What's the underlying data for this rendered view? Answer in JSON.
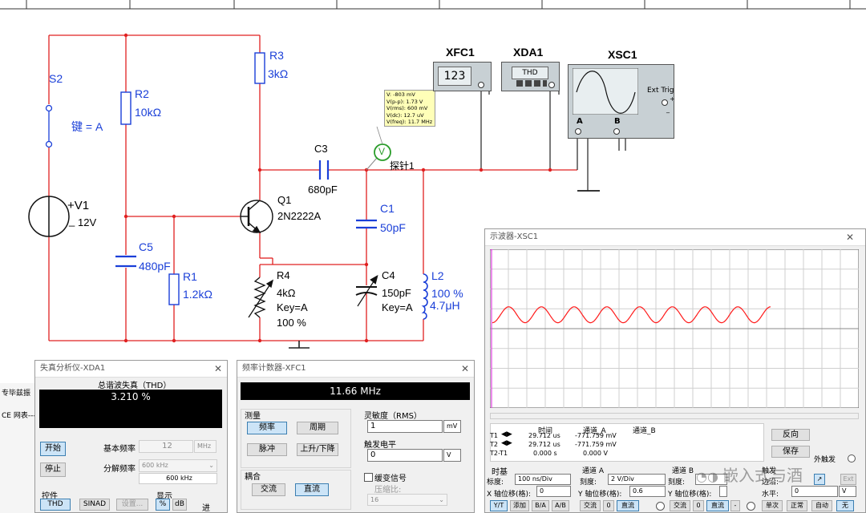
{
  "schematic": {
    "s2": {
      "name": "S2",
      "key": "键 = A"
    },
    "v1": {
      "name": "+V1",
      "value": "12V",
      "minus": "_"
    },
    "r2": {
      "name": "R2",
      "value": "10kΩ"
    },
    "r3": {
      "name": "R3",
      "value": "3kΩ"
    },
    "q1": {
      "name": "Q1",
      "model": "2N2222A"
    },
    "c5": {
      "name": "C5",
      "value": "480pF"
    },
    "r1": {
      "name": "R1",
      "value": "1.2kΩ"
    },
    "r4": {
      "name": "R4",
      "value": "4kΩ",
      "key": "Key=A",
      "percent": "100 %"
    },
    "c3": {
      "name": "C3",
      "value": "680pF"
    },
    "c1": {
      "name": "C1",
      "value": "50pF"
    },
    "c4": {
      "name": "C4",
      "value": "150pF",
      "key": "Key=A"
    },
    "l2": {
      "name": "L2",
      "percent": "100 %",
      "value": "4.7μH"
    },
    "probe": {
      "name": "探针1",
      "symbol": "V",
      "lines": [
        "V: -803 mV",
        "V(p-p): 1.73 V",
        "V(rms): 600 mV",
        "V(dc): 12.7 uV",
        "V(freq): 11.7 MHz"
      ]
    },
    "xfc1": {
      "name": "XFC1",
      "display": "123"
    },
    "xda1": {
      "name": "XDA1",
      "display": "THD"
    },
    "xsc1": {
      "name": "XSC1",
      "ext_trig": "Ext Trig",
      "ch_a": "A",
      "ch_b": "B",
      "plus": "+",
      "minus": "_"
    }
  },
  "thd_window": {
    "title": "失真分析仪-XDA1",
    "section": "总谐波失真（THD）",
    "value": "3.210 %",
    "start": "开始",
    "stop": "停止",
    "fundamental_label": "基本频率",
    "fundamental_value": "12",
    "fundamental_unit": "MHz",
    "resolution_label": "分解频率",
    "resolution_value": "600 kHz",
    "resolution_display": "600 kHz",
    "control_label": "控件",
    "controls": [
      "THD",
      "SINAD",
      "设置..."
    ],
    "display_label": "显示",
    "display_opts": [
      "%",
      "dB"
    ],
    "extra": "进"
  },
  "left_strip": {
    "items": [
      "专毕兹振",
      "CE 网表---"
    ]
  },
  "freq_window": {
    "title": "频率计数器-XFC1",
    "value": "11.66 MHz",
    "measure_label": "测量",
    "measure_buttons": [
      "频率",
      "周期",
      "脉冲",
      "上升/下降"
    ],
    "coupling_label": "耦合",
    "coupling_buttons": [
      "交流",
      "直流"
    ],
    "sensitivity_label": "灵敏度（RMS）",
    "sensitivity_value": "1",
    "sensitivity_unit": "mV",
    "trigger_label": "触发电平",
    "trigger_value": "0",
    "trigger_unit": "V",
    "slow_label": "缓变信号",
    "compress_label": "压缩比:",
    "compress_value": "16"
  },
  "scope_window": {
    "title": "示波器-XSC1",
    "waveform": {
      "cycles": 8.5,
      "amplitude_div": 0.4,
      "offset_div": 0.7
    },
    "cursor_header": [
      "时间",
      "通道_A",
      "通道_B"
    ],
    "cursor_rows": [
      {
        "label": "T1",
        "time": "29.712 us",
        "a": "-771.759 mV",
        "b": ""
      },
      {
        "label": "T2",
        "time": "29.712 us",
        "a": "-771.759 mV",
        "b": ""
      },
      {
        "label": "T2-T1",
        "time": "0.000 s",
        "a": "0.000 V",
        "b": ""
      }
    ],
    "reverse": "反向",
    "save": "保存",
    "ext_trigger": "外触发",
    "timebase_label": "时基",
    "timebase_scale_label": "标度:",
    "timebase_scale": "100 ns/Div",
    "x_pos_label": "X 轴位移(格):",
    "x_pos": "0",
    "timebase_modes": [
      "Y/T",
      "添加",
      "B/A",
      "A/B"
    ],
    "ch_a_label": "通道 A",
    "ch_a_scale_label": "刻度:",
    "ch_a_scale": "2 V/Div",
    "ch_a_pos_label": "Y 轴位移(格):",
    "ch_a_pos": "0.6",
    "ch_a_modes": [
      "交流",
      "0",
      "直流"
    ],
    "ch_b_label": "通道 B",
    "ch_b_scale_label": "刻度:",
    "ch_b_pos_label": "Y 轴位移(格):",
    "ch_b_modes": [
      "交流",
      "0",
      "直流",
      "-"
    ],
    "trig_label": "触发",
    "trig_edge_label": "边沿:",
    "trig_level_label": "水平:",
    "trig_level": "0",
    "trig_unit": "V",
    "trig_source": "Ext",
    "trig_modes": [
      "单次",
      "正常",
      "自动",
      "无"
    ]
  },
  "watermark": "嵌入式与酒",
  "colors": {
    "wire": "#e02020",
    "label": "#1a3fd8",
    "wave": "#ff1a1a",
    "display_bg": "#000000"
  }
}
